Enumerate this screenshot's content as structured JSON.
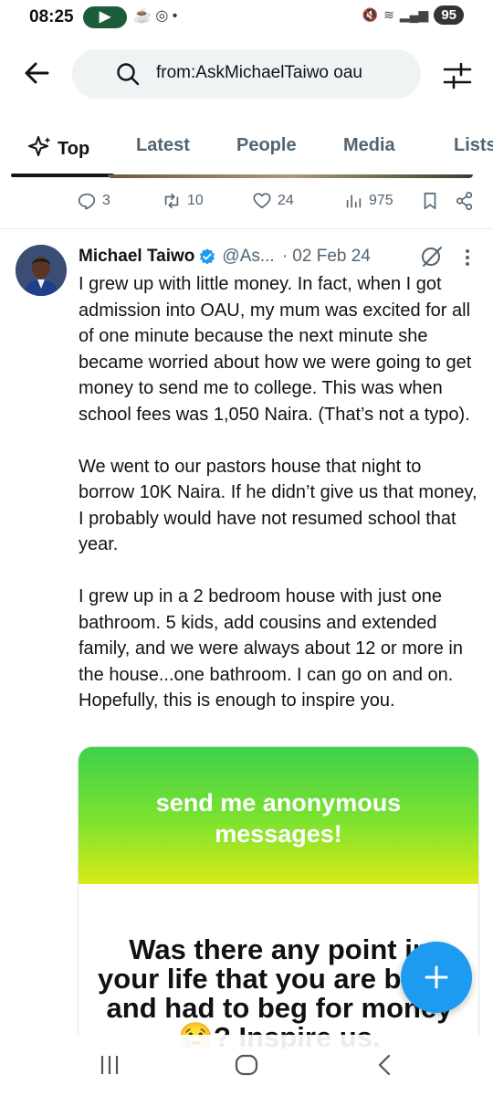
{
  "status_bar": {
    "time": "08:25",
    "battery": "95"
  },
  "search": {
    "query": "from:AskMichaelTaiwo oau"
  },
  "tabs": [
    {
      "label": "Top",
      "active": true
    },
    {
      "label": "Latest",
      "active": false
    },
    {
      "label": "People",
      "active": false
    },
    {
      "label": "Media",
      "active": false
    },
    {
      "label": "Lists",
      "active": false
    }
  ],
  "prev_tweet_actions": {
    "replies": "3",
    "reposts": "10",
    "likes": "24",
    "views": "975"
  },
  "tweet": {
    "author_name": "Michael Taiwo",
    "handle": "@As...",
    "date": "· 02 Feb 24",
    "paragraphs": [
      "I grew up with little money. In fact, when I got admission into OAU, my mum was excited for all of one minute because the next minute she became worried about how we were going to get money to send me to college. This was when school fees was 1,050 Naira. (That’s not a typo).",
      "We went to our pastors house that night to borrow 10K Naira. If he didn’t give us that money, I probably would have not resumed school that year.",
      "I grew up in a 2 bedroom house with just one bathroom. 5 kids, add cousins and extended family, and we were always about 12 or more in the house...one bathroom. I can go on and on. Hopefully, this is enough to inspire you."
    ],
    "media": {
      "header_line1": "send me anonymous",
      "header_line2": "messages!",
      "question": "Was there any point in your life that you are broke and had to beg for money😢? Inspire us."
    }
  },
  "colors": {
    "accent": "#1d9bf0",
    "text": "#0f1419",
    "muted": "#536471"
  }
}
